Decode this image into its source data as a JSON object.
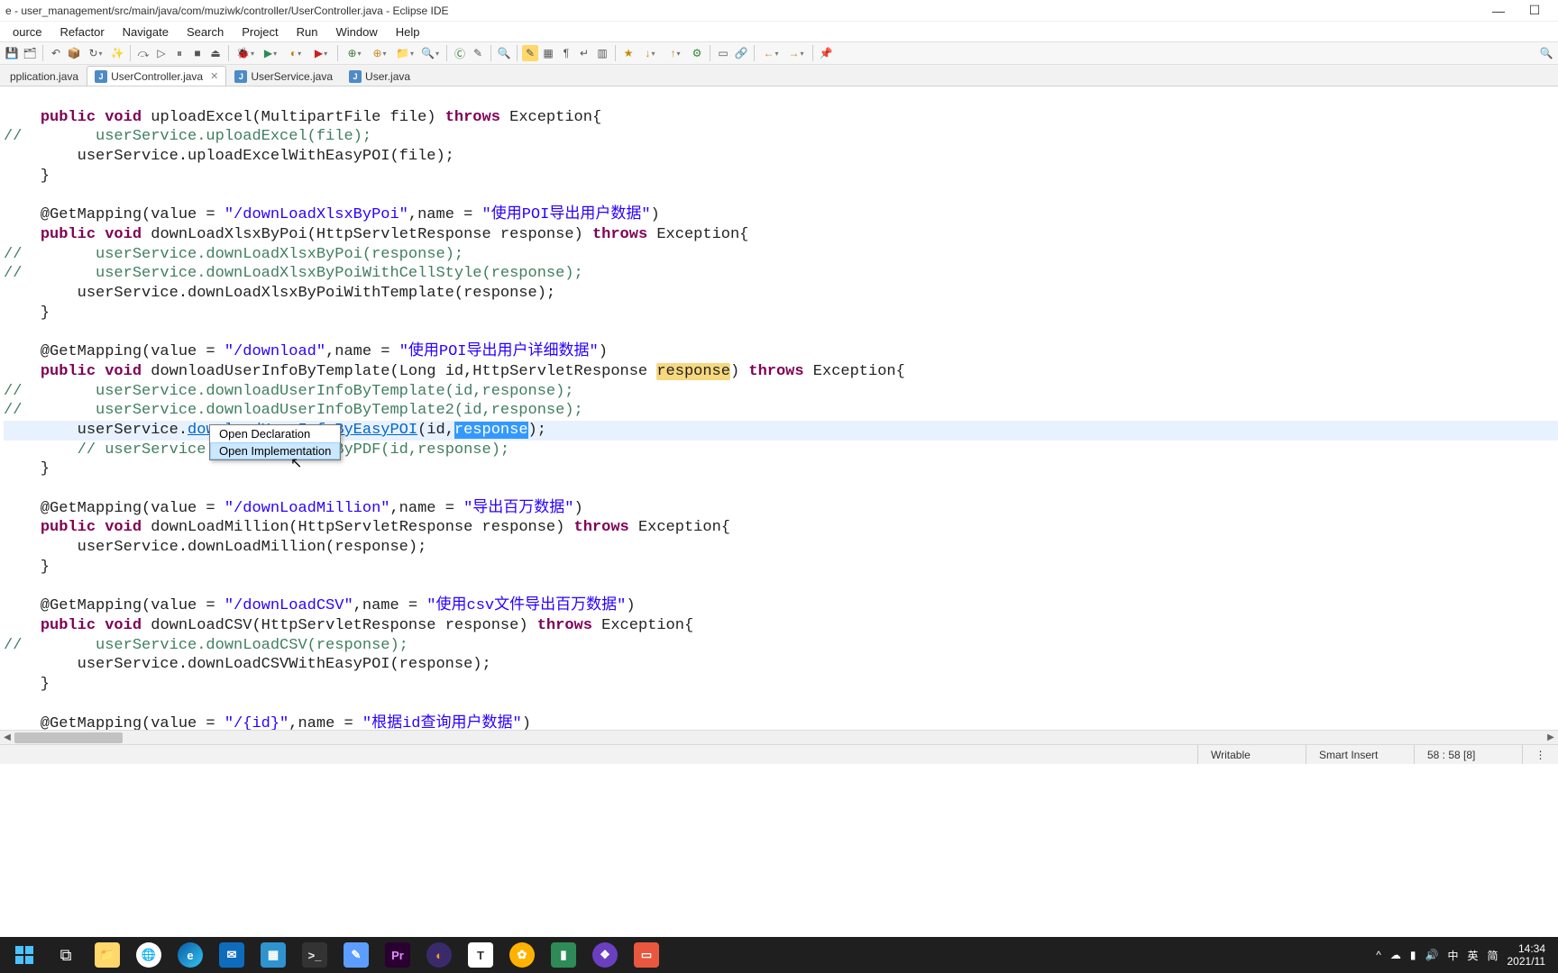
{
  "window": {
    "title": "e - user_management/src/main/java/com/muziwk/controller/UserController.java - Eclipse IDE"
  },
  "menu": [
    "ource",
    "Refactor",
    "Navigate",
    "Search",
    "Project",
    "Run",
    "Window",
    "Help"
  ],
  "tabs": [
    {
      "label": "pplication.java",
      "active": false,
      "closable": false
    },
    {
      "label": "UserController.java",
      "active": true,
      "closable": true
    },
    {
      "label": "UserService.java",
      "active": false,
      "closable": false
    },
    {
      "label": "User.java",
      "active": false,
      "closable": false
    }
  ],
  "popup": {
    "items": [
      "Open Declaration",
      "Open Implementation"
    ],
    "hoverIndex": 1
  },
  "code": {
    "l1_a": "    ",
    "l1_kw1": "public",
    "l1_b": " ",
    "l1_kw2": "void",
    "l1_c": " uploadExcel(MultipartFile file) ",
    "l1_kw3": "throws",
    "l1_d": " Exception{",
    "l2": "//        userService.uploadExcel(file);",
    "l3": "        userService.uploadExcelWithEasyPOI(file);",
    "l4": "    }",
    "l5": "",
    "l6_a": "    @GetMapping(value = ",
    "l6_s1": "\"/downLoadXlsxByPoi\"",
    "l6_b": ",name = ",
    "l6_s2": "\"使用POI导出用户数据\"",
    "l6_c": ")",
    "l7_a": "    ",
    "l7_kw1": "public",
    "l7_b": " ",
    "l7_kw2": "void",
    "l7_c": " downLoadXlsxByPoi(HttpServletResponse response) ",
    "l7_kw3": "throws",
    "l7_d": " Exception{",
    "l8": "//        userService.downLoadXlsxByPoi(response);",
    "l9": "//        userService.downLoadXlsxByPoiWithCellStyle(response);",
    "l10": "        userService.downLoadXlsxByPoiWithTemplate(response);",
    "l11": "    }",
    "l12": "",
    "l13_a": "    @GetMapping(value = ",
    "l13_s1": "\"/download\"",
    "l13_b": ",name = ",
    "l13_s2": "\"使用POI导出用户详细数据\"",
    "l13_c": ")",
    "l14_a": "    ",
    "l14_kw1": "public",
    "l14_b": " ",
    "l14_kw2": "void",
    "l14_c": " downloadUserInfoByTemplate(Long id,HttpServletResponse ",
    "l14_occ": "response",
    "l14_d": ") ",
    "l14_kw3": "throws",
    "l14_e": " Exception{",
    "l15": "//        userService.downloadUserInfoByTemplate(id,response);",
    "l16": "//        userService.downloadUserInfoByTemplate2(id,response);",
    "l17_a": "        userService.",
    "l17_link": "downloadUserInfoByEasyPOI",
    "l17_b": "(id,",
    "l17_sel": "response",
    "l17_c": ");",
    "l18_a": "        ",
    "l18_cmt": "// userService.           foByPDF(id,response);",
    "l19": "    }",
    "l20": "",
    "l21_a": "    @GetMapping(value = ",
    "l21_s1": "\"/downLoadMillion\"",
    "l21_b": ",name = ",
    "l21_s2": "\"导出百万数据\"",
    "l21_c": ")",
    "l22_a": "    ",
    "l22_kw1": "public",
    "l22_b": " ",
    "l22_kw2": "void",
    "l22_c": " downLoadMillion(HttpServletResponse response) ",
    "l22_kw3": "throws",
    "l22_e": " Exception{",
    "l23": "        userService.downLoadMillion(response);",
    "l24": "    }",
    "l25": "",
    "l26_a": "    @GetMapping(value = ",
    "l26_s1": "\"/downLoadCSV\"",
    "l26_b": ",name = ",
    "l26_s2": "\"使用csv文件导出百万数据\"",
    "l26_c": ")",
    "l27_a": "    ",
    "l27_kw1": "public",
    "l27_b": " ",
    "l27_kw2": "void",
    "l27_c": " downLoadCSV(HttpServletResponse response) ",
    "l27_kw3": "throws",
    "l27_e": " Exception{",
    "l28": "//        userService.downLoadCSV(response);",
    "l29": "        userService.downLoadCSVWithEasyPOI(response);",
    "l30": "    }",
    "l31": "",
    "l32_a": "    @GetMapping(value = ",
    "l32_s1": "\"/{id}\"",
    "l32_b": ",name = ",
    "l32_s2": "\"根据id查询用户数据\"",
    "l32_c": ")"
  },
  "status": {
    "writable": "Writable",
    "insert": "Smart Insert",
    "pos": "58 : 58 [8]"
  },
  "tray": {
    "chevron": "^",
    "cloud": "☁",
    "battery": "▮",
    "speaker": "🔊",
    "ime1": "中",
    "ime2": "英",
    "ime3": "简",
    "time": "14:34",
    "date": "2021/11"
  }
}
